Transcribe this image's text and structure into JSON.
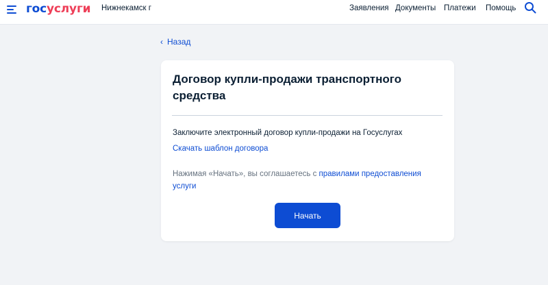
{
  "header": {
    "logo_part1": "гос",
    "logo_part2": "услуги",
    "city": "Нижнекамск г",
    "nav": [
      "Заявления",
      "Документы",
      "Платежи",
      "Помощь"
    ],
    "icons": {
      "menu": "menu-icon",
      "search": "search-icon"
    }
  },
  "back": {
    "label": "Назад"
  },
  "card": {
    "title": "Договор купли-продажи транспортного средства",
    "lead": "Заключите электронный договор купли-продажи на Госуслугах",
    "download_link": "Скачать шаблон договора",
    "agree_prefix": "Нажимая «Начать», вы соглашаетесь с ",
    "agree_link": "правилами предоставления услуги",
    "start_button": "Начать"
  },
  "colors": {
    "brand_blue": "#0d4cd3",
    "brand_red": "#ee3f58",
    "background": "#f1f3f6",
    "text": "#0b1f33",
    "muted_text": "#66727f"
  }
}
